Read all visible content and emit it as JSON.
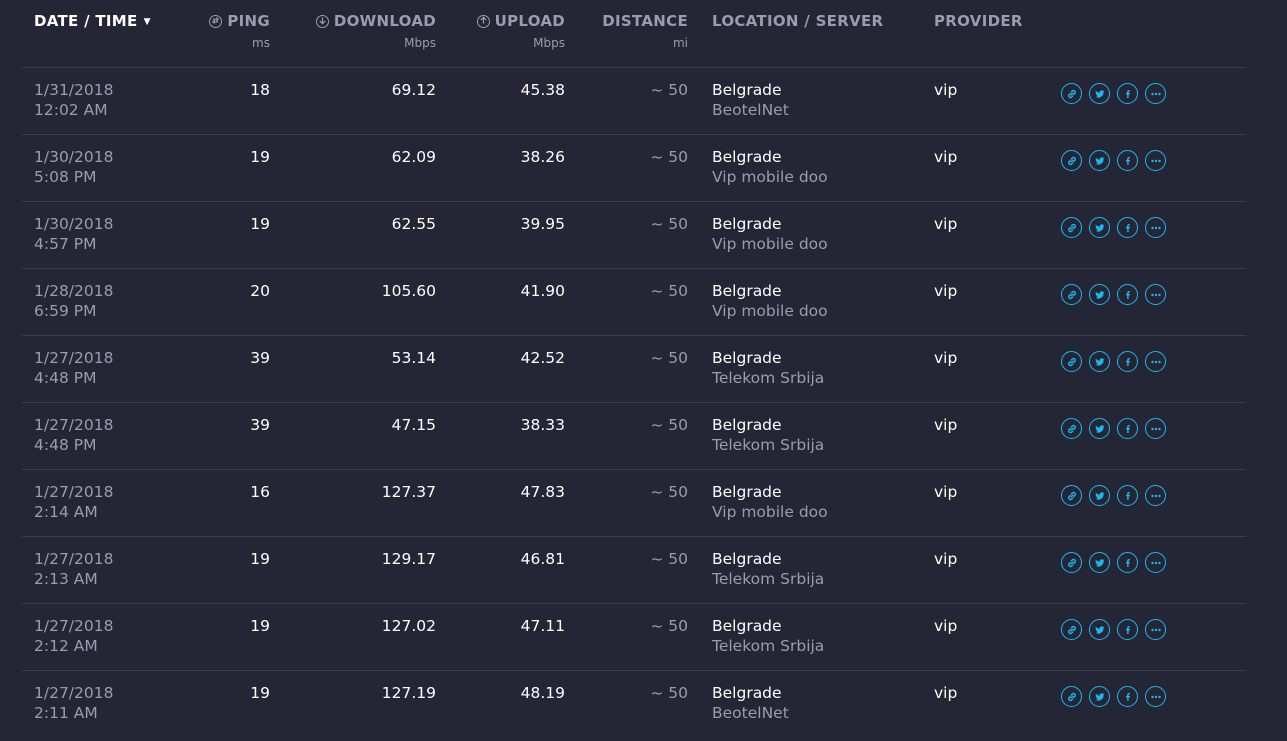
{
  "header": {
    "date_time": "DATE / TIME",
    "ping": "PING",
    "ping_unit": "ms",
    "download": "DOWNLOAD",
    "download_unit": "Mbps",
    "upload": "UPLOAD",
    "upload_unit": "Mbps",
    "distance": "DISTANCE",
    "distance_unit": "mi",
    "location": "LOCATION / SERVER",
    "provider": "PROVIDER"
  },
  "colors": {
    "background": "#242535",
    "accent": "#1ab8f2",
    "muted_text": "#9a9cb0",
    "divider": "#3a3c50"
  },
  "action_icons": [
    "link-icon",
    "twitter-icon",
    "facebook-icon",
    "more-icon"
  ],
  "rows": [
    {
      "date": "1/31/2018",
      "time": "12:02 AM",
      "ping": "18",
      "download": "69.12",
      "upload": "45.38",
      "distance": "~ 50",
      "city": "Belgrade",
      "server": "BeotelNet",
      "provider": "vip"
    },
    {
      "date": "1/30/2018",
      "time": "5:08 PM",
      "ping": "19",
      "download": "62.09",
      "upload": "38.26",
      "distance": "~ 50",
      "city": "Belgrade",
      "server": "Vip mobile doo",
      "provider": "vip"
    },
    {
      "date": "1/30/2018",
      "time": "4:57 PM",
      "ping": "19",
      "download": "62.55",
      "upload": "39.95",
      "distance": "~ 50",
      "city": "Belgrade",
      "server": "Vip mobile doo",
      "provider": "vip"
    },
    {
      "date": "1/28/2018",
      "time": "6:59 PM",
      "ping": "20",
      "download": "105.60",
      "upload": "41.90",
      "distance": "~ 50",
      "city": "Belgrade",
      "server": "Vip mobile doo",
      "provider": "vip"
    },
    {
      "date": "1/27/2018",
      "time": "4:48 PM",
      "ping": "39",
      "download": "53.14",
      "upload": "42.52",
      "distance": "~ 50",
      "city": "Belgrade",
      "server": "Telekom Srbija",
      "provider": "vip"
    },
    {
      "date": "1/27/2018",
      "time": "4:48 PM",
      "ping": "39",
      "download": "47.15",
      "upload": "38.33",
      "distance": "~ 50",
      "city": "Belgrade",
      "server": "Telekom Srbija",
      "provider": "vip"
    },
    {
      "date": "1/27/2018",
      "time": "2:14 AM",
      "ping": "16",
      "download": "127.37",
      "upload": "47.83",
      "distance": "~ 50",
      "city": "Belgrade",
      "server": "Vip mobile doo",
      "provider": "vip"
    },
    {
      "date": "1/27/2018",
      "time": "2:13 AM",
      "ping": "19",
      "download": "129.17",
      "upload": "46.81",
      "distance": "~ 50",
      "city": "Belgrade",
      "server": "Telekom Srbija",
      "provider": "vip"
    },
    {
      "date": "1/27/2018",
      "time": "2:12 AM",
      "ping": "19",
      "download": "127.02",
      "upload": "47.11",
      "distance": "~ 50",
      "city": "Belgrade",
      "server": "Telekom Srbija",
      "provider": "vip"
    },
    {
      "date": "1/27/2018",
      "time": "2:11 AM",
      "ping": "19",
      "download": "127.19",
      "upload": "48.19",
      "distance": "~ 50",
      "city": "Belgrade",
      "server": "BeotelNet",
      "provider": "vip"
    }
  ]
}
